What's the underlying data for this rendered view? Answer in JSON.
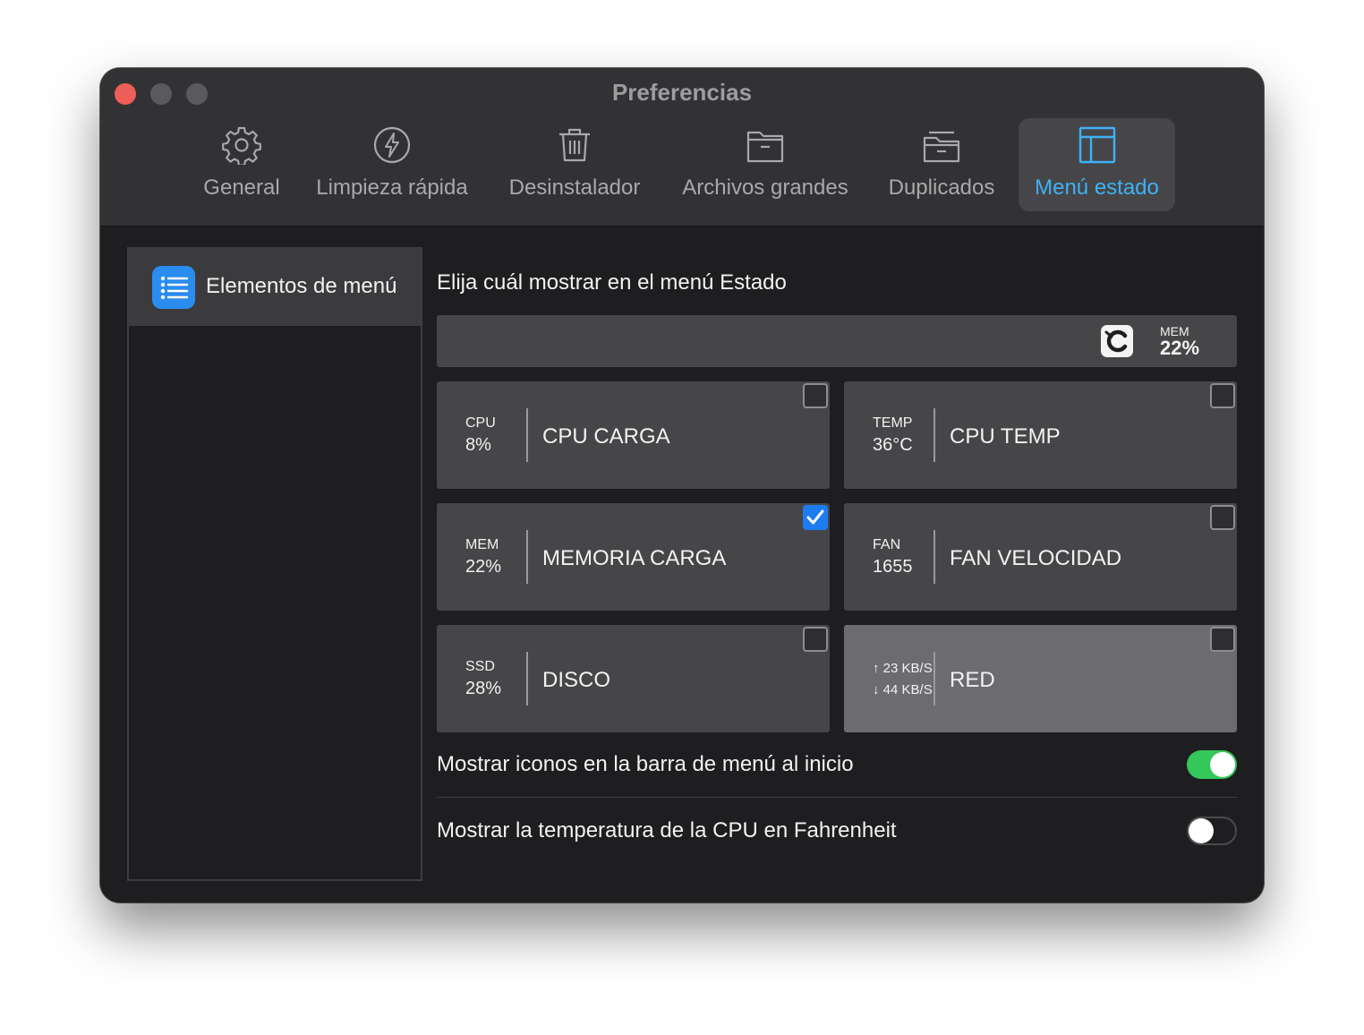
{
  "window": {
    "title": "Preferencias"
  },
  "tabs": [
    {
      "label": "General",
      "icon": "gear-icon"
    },
    {
      "label": "Limpieza rápida",
      "icon": "lightning-icon"
    },
    {
      "label": "Desinstalador",
      "icon": "trash-icon"
    },
    {
      "label": "Archivos grandes",
      "icon": "folder-icon"
    },
    {
      "label": "Duplicados",
      "icon": "duplicate-folder-icon"
    },
    {
      "label": "Menú estado",
      "icon": "layout-icon",
      "active": true
    }
  ],
  "sidebar": {
    "items": [
      {
        "label": "Elementos de menú",
        "icon": "list-icon",
        "selected": true
      }
    ]
  },
  "content": {
    "title": "Elija cuál mostrar en el menú Estado",
    "preview": {
      "mem_label": "MEM",
      "mem_value": "22%"
    },
    "tiles": [
      {
        "small_label": "CPU",
        "small_value": "8%",
        "label": "CPU CARGA",
        "checked": false
      },
      {
        "small_label": "TEMP",
        "small_value": "36°C",
        "label": "CPU TEMP",
        "checked": false
      },
      {
        "small_label": "MEM",
        "small_value": "22%",
        "label": "MEMORIA CARGA",
        "checked": true
      },
      {
        "small_label": "FAN",
        "small_value": "1655",
        "label": "FAN VELOCIDAD",
        "checked": false
      },
      {
        "small_label": "SSD",
        "small_value": "28%",
        "label": "DISCO",
        "checked": false
      },
      {
        "net_up": "↑ 23 KB/S",
        "net_down": "↓ 44 KB/S",
        "label": "RED",
        "checked": false
      }
    ],
    "options": [
      {
        "label": "Mostrar iconos en la barra de menú al inicio",
        "enabled": true
      },
      {
        "label": "Mostrar la temperatura de la CPU en Fahrenheit",
        "enabled": false
      }
    ]
  },
  "colors": {
    "accent": "#3eb2f4",
    "checkbox_checked": "#1c7cf2",
    "toggle_on": "#34c759",
    "close_button": "#ec5e57"
  }
}
